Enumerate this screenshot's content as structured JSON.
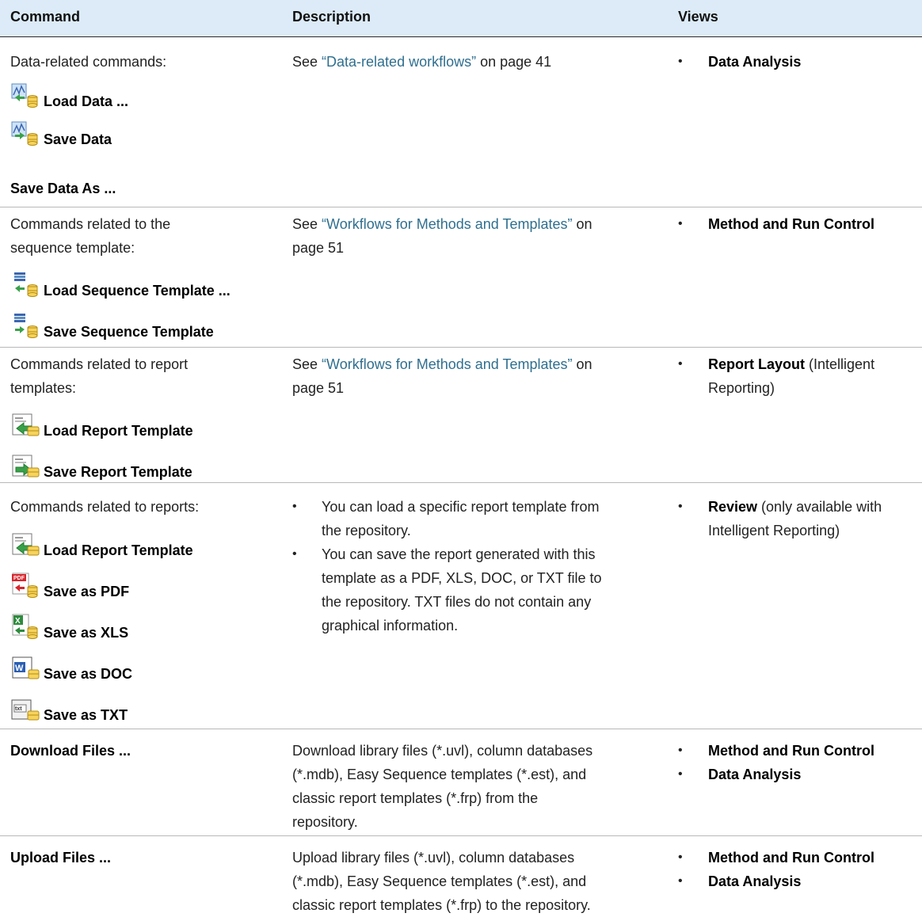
{
  "header": {
    "command": "Command",
    "description": "Description",
    "views": "Views"
  },
  "rows": [
    {
      "intro": "Data-related commands:",
      "commands": [
        "Load Data ...",
        "Save Data",
        "Save Data As ..."
      ],
      "desc_prefix": "See ",
      "desc_link": "“Data-related workflows”",
      "desc_suffix": " on page 41",
      "views": [
        {
          "bold": "Data Analysis",
          "rest": ""
        }
      ]
    },
    {
      "intro_line1": "Commands related to the",
      "intro_line2": "sequence template:",
      "commands": [
        "Load Sequence Template ...",
        "Save Sequence Template"
      ],
      "desc_prefix": "See ",
      "desc_link": "“Workflows for Methods and Templates”",
      "desc_suffix": " on",
      "desc_line2": "page 51",
      "views": [
        {
          "bold": "Method and Run Control",
          "rest": ""
        }
      ]
    },
    {
      "intro_line1": "Commands related to report",
      "intro_line2": "templates:",
      "commands": [
        "Load Report Template",
        "Save Report Template"
      ],
      "desc_prefix": "See ",
      "desc_link": "“Workflows for Methods and Templates”",
      "desc_suffix": " on",
      "desc_line2": "page 51",
      "views": [
        {
          "bold": "Report Layout",
          "rest": " (Intelligent",
          "line2": "Reporting)"
        }
      ]
    },
    {
      "intro": "Commands related to reports:",
      "commands": [
        "Load Report Template",
        "Save as PDF",
        "Save as XLS",
        "Save as DOC",
        "Save as TXT"
      ],
      "bullets": [
        [
          "You can load a specific report template from",
          "the repository."
        ],
        [
          "You can save the report generated with this",
          "template as a PDF, XLS, DOC, or TXT file to",
          "the repository. TXT files do not contain any",
          "graphical information."
        ]
      ],
      "views": [
        {
          "bold": "Review",
          "rest": " (only available with",
          "line2": "Intelligent Reporting)"
        }
      ]
    },
    {
      "command": "Download Files ...",
      "desc_lines": [
        "Download library files (*.uvl), column databases",
        "(*.mdb), Easy Sequence templates (*.est), and",
        "classic report templates (*.frp) from the",
        "repository."
      ],
      "views": [
        {
          "bold": "Method and Run Control"
        },
        {
          "bold": "Data Analysis"
        }
      ]
    },
    {
      "command": "Upload Files ...",
      "desc_lines": [
        "Upload library files (*.uvl), column databases",
        "(*.mdb), Easy Sequence templates (*.est), and",
        "classic report templates (*.frp) to the repository."
      ],
      "views": [
        {
          "bold": "Method and Run Control"
        },
        {
          "bold": "Data Analysis"
        }
      ]
    }
  ],
  "icons": {
    "data": "data-db-icon",
    "sequence": "sequence-db-icon",
    "report": "report-template-icon",
    "pdf": "pdf-icon",
    "xls": "xls-icon",
    "doc": "doc-icon",
    "txt": "txt-icon"
  }
}
